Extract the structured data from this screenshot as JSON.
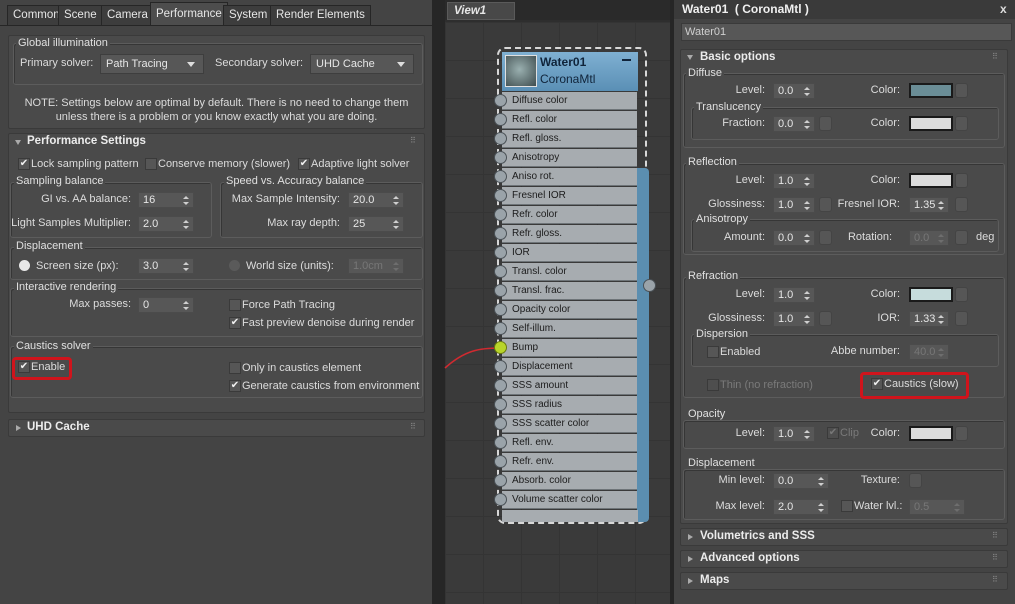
{
  "left": {
    "tabs": [
      "Common",
      "Scene",
      "Camera",
      "Performance",
      "System",
      "Render Elements"
    ],
    "active_tab": "Performance",
    "gi": {
      "title": "Global illumination",
      "primary_label": "Primary solver:",
      "primary_value": "Path Tracing",
      "secondary_label": "Secondary solver:",
      "secondary_value": "UHD Cache"
    },
    "note": [
      "NOTE: Settings below are optimal by default. There is no need to change them",
      "unless there is a problem or you know exactly what you are doing."
    ],
    "perf": {
      "title": "Performance Settings",
      "lock": "Lock sampling pattern",
      "conserve": "Conserve memory (slower)",
      "adaptive": "Adaptive light solver",
      "sampling": {
        "title": "Sampling balance",
        "gi_aa_label": "GI vs. AA balance:",
        "gi_aa": "16",
        "lsm_label": "Light Samples Multiplier:",
        "lsm": "2.0"
      },
      "speed": {
        "title": "Speed vs. Accuracy balance",
        "msi_label": "Max Sample Intensity:",
        "msi": "20.0",
        "mrd_label": "Max ray depth:",
        "mrd": "25"
      },
      "disp": {
        "title": "Displacement",
        "screen_label": "Screen size (px):",
        "screen": "3.0",
        "world_label": "World size (units):",
        "world": "1.0cm"
      },
      "ir": {
        "title": "Interactive rendering",
        "max_passes_label": "Max passes:",
        "max_passes": "0",
        "force_pt": "Force Path Tracing",
        "fast_preview": "Fast preview denoise during render"
      },
      "caustics": {
        "title": "Caustics solver",
        "enable": "Enable",
        "only": "Only in caustics element",
        "generate": "Generate caustics from environment"
      }
    },
    "uhd": "UHD Cache"
  },
  "view": {
    "tab": "View1",
    "node_name": "Water01",
    "node_type": "CoronaMtl",
    "slots": [
      "Diffuse color",
      "Refl. color",
      "Refl. gloss.",
      "Anisotropy",
      "Aniso rot.",
      "Fresnel IOR",
      "Refr. color",
      "Refr. gloss.",
      "IOR",
      "Transl. color",
      "Transl. frac.",
      "Opacity color",
      "Self-illum.",
      "Bump",
      "Displacement",
      "SSS amount",
      "SSS radius",
      "SSS scatter color",
      "Refl. env.",
      "Refr. env.",
      "Absorb. color",
      "Volume scatter color"
    ],
    "connected_slot": "Bump"
  },
  "right": {
    "title": "Water01  ( CoronaMtl )",
    "close": "x",
    "name_value": "Water01",
    "basic": "Basic options",
    "diffuse": {
      "title": "Diffuse",
      "level_label": "Level:",
      "level": "0.0",
      "color_label": "Color:",
      "color": "#6a8d96",
      "transl": {
        "title": "Translucency",
        "fraction_label": "Fraction:",
        "fraction": "0.0",
        "color_label": "Color:",
        "color": "#dcdcdc"
      }
    },
    "reflection": {
      "title": "Reflection",
      "level_label": "Level:",
      "level": "1.0",
      "color_label": "Color:",
      "color": "#dcdcdc",
      "gloss_label": "Glossiness:",
      "gloss": "1.0",
      "fior_label": "Fresnel IOR:",
      "fior": "1.35",
      "aniso": {
        "title": "Anisotropy",
        "amount_label": "Amount:",
        "amount": "0.0",
        "rotation_label": "Rotation:",
        "rotation": "0.0",
        "unit": "deg"
      }
    },
    "refraction": {
      "title": "Refraction",
      "level_label": "Level:",
      "level": "1.0",
      "color_label": "Color:",
      "color": "#c6dcdc",
      "gloss_label": "Glossiness:",
      "gloss": "1.0",
      "ior_label": "IOR:",
      "ior": "1.33",
      "dispersion": {
        "title": "Dispersion",
        "enabled": "Enabled",
        "abbe_label": "Abbe number:",
        "abbe": "40.0"
      },
      "thin": "Thin (no refraction)",
      "caustics": "Caustics (slow)"
    },
    "opacity": {
      "title": "Opacity",
      "level_label": "Level:",
      "level": "1.0",
      "clip": "Clip",
      "color_label": "Color:",
      "color": "#dcdcdc"
    },
    "displacement": {
      "title": "Displacement",
      "min_label": "Min level:",
      "min": "0.0",
      "texture_label": "Texture:",
      "max_label": "Max level:",
      "max": "2.0",
      "water_label": "Water lvl.:",
      "water": "0.5"
    },
    "rollouts": [
      "Volumetrics and SSS",
      "Advanced options",
      "Maps"
    ]
  }
}
